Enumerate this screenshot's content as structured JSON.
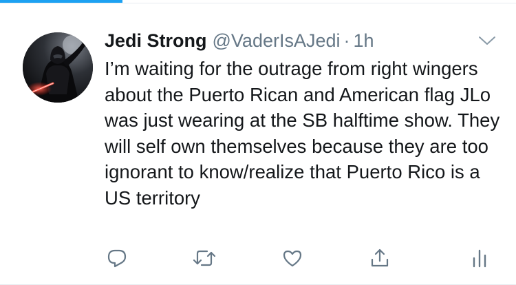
{
  "colors": {
    "accent": "#1da1f2",
    "text": "#14171a",
    "muted": "#657786",
    "divider": "#e6ecf0"
  },
  "tweet": {
    "author": {
      "display_name": "Jedi Strong",
      "handle": "@VaderIsAJedi",
      "avatar_icon": "darth-vader-avatar"
    },
    "separator": "·",
    "time": "1h",
    "text": "I’m waiting for the outrage from right wingers about the Puerto Rican and American flag JLo was just wearing at the SB halftime show. They will self own themselves because they are too ignorant to know/realize that Puerto Rico is a  US territory",
    "menu_icon": "chevron-down-icon",
    "actions": [
      {
        "name": "reply",
        "icon": "reply-icon"
      },
      {
        "name": "retweet",
        "icon": "retweet-icon"
      },
      {
        "name": "like",
        "icon": "heart-icon"
      },
      {
        "name": "share",
        "icon": "share-icon"
      },
      {
        "name": "analytics",
        "icon": "analytics-icon"
      }
    ]
  }
}
